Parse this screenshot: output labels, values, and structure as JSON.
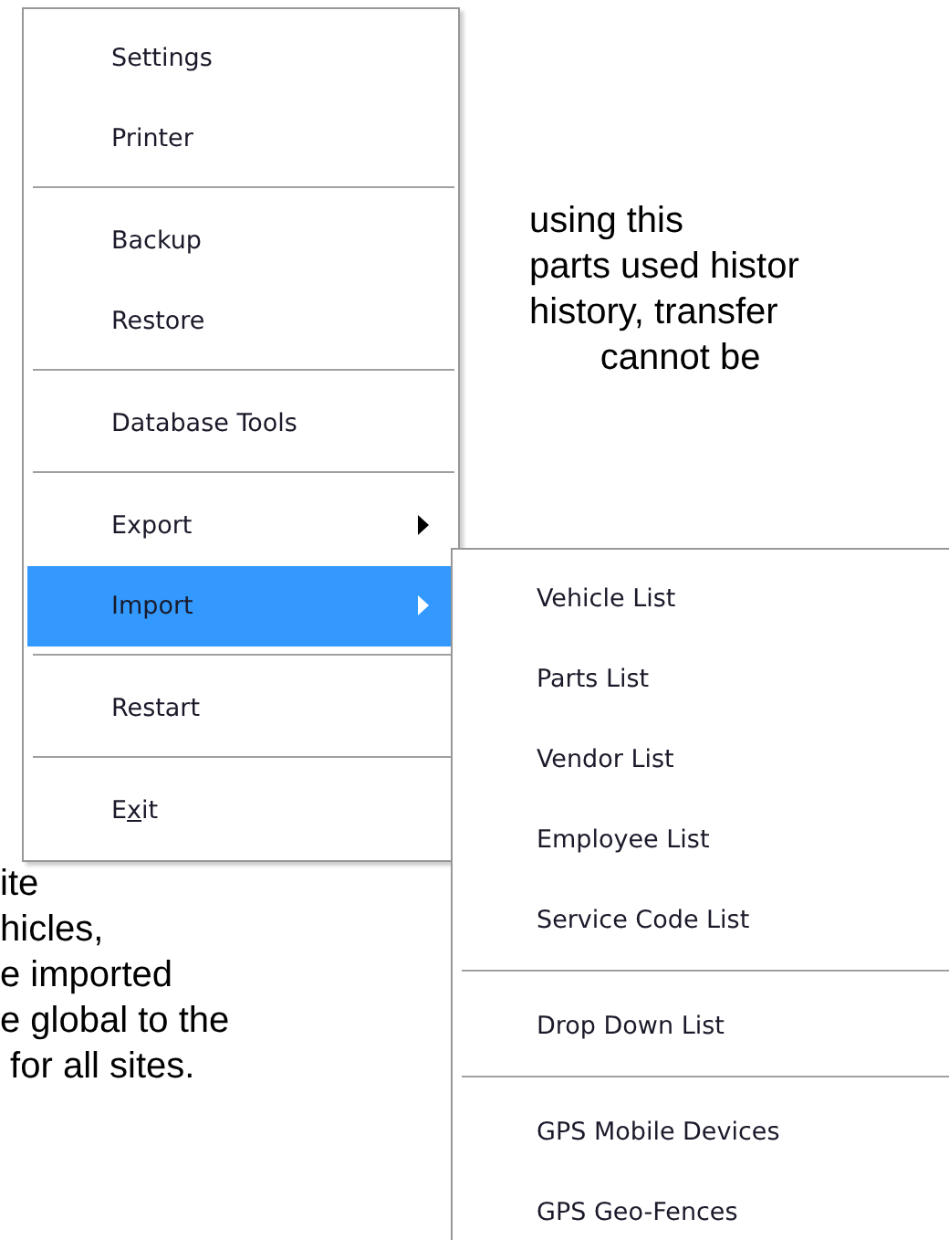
{
  "document_text": {
    "upper_lines": [
      "using this",
      "parts used histor",
      "history, transfer",
      "       cannot be"
    ],
    "lower_lines": [
      "ite",
      "hicles,",
      "e imported",
      "e global to the",
      " for all sites."
    ]
  },
  "main_menu": {
    "items": [
      {
        "kind": "item",
        "label": "Settings",
        "submenu": false,
        "selected": false
      },
      {
        "kind": "item",
        "label": "Printer",
        "submenu": false,
        "selected": false
      },
      {
        "kind": "separator"
      },
      {
        "kind": "item",
        "label": "Backup",
        "submenu": false,
        "selected": false
      },
      {
        "kind": "item",
        "label": "Restore",
        "submenu": false,
        "selected": false
      },
      {
        "kind": "separator"
      },
      {
        "kind": "item",
        "label": "Database Tools",
        "submenu": false,
        "selected": false
      },
      {
        "kind": "separator"
      },
      {
        "kind": "item",
        "label": "Export",
        "submenu": true,
        "selected": false
      },
      {
        "kind": "item",
        "label": "Import",
        "submenu": true,
        "selected": true
      },
      {
        "kind": "separator"
      },
      {
        "kind": "item",
        "label": "Restart",
        "submenu": false,
        "selected": false
      },
      {
        "kind": "separator"
      },
      {
        "kind": "item",
        "label_before": "E",
        "access_key": "x",
        "label_after": "it",
        "submenu": false,
        "selected": false
      }
    ]
  },
  "import_submenu": {
    "items": [
      {
        "kind": "item",
        "label": "Vehicle List"
      },
      {
        "kind": "item",
        "label": "Parts List"
      },
      {
        "kind": "item",
        "label": "Vendor List"
      },
      {
        "kind": "item",
        "label": "Employee List"
      },
      {
        "kind": "item",
        "label": "Service Code List"
      },
      {
        "kind": "separator"
      },
      {
        "kind": "item",
        "label": "Drop Down List"
      },
      {
        "kind": "separator"
      },
      {
        "kind": "item",
        "label": "GPS Mobile Devices"
      },
      {
        "kind": "item",
        "label": "GPS Geo-Fences"
      }
    ]
  }
}
